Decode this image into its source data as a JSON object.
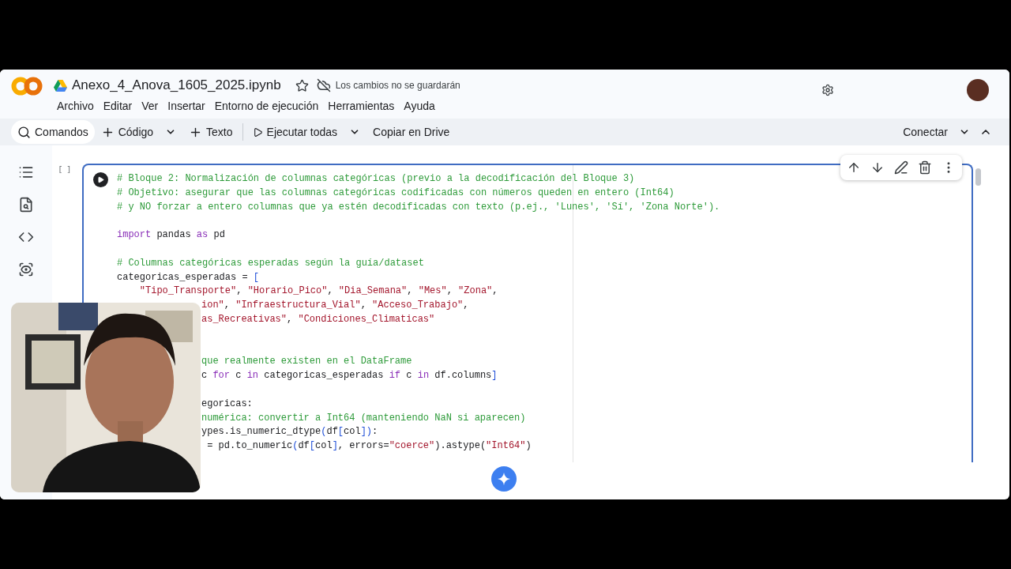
{
  "header": {
    "file_name": "Anexo_4_Anova_1605_2025.ipynb",
    "starred": false,
    "save_status": "Los cambios no se guardarán"
  },
  "menu": [
    "Archivo",
    "Editar",
    "Ver",
    "Insertar",
    "Entorno de ejecución",
    "Herramientas",
    "Ayuda"
  ],
  "toolbar": [
    {
      "label": "Comandos",
      "kind": "search",
      "dropdown": false
    },
    {
      "label": "Código",
      "kind": "add",
      "dropdown": true
    },
    {
      "label": "Texto",
      "kind": "add",
      "dropdown": false
    },
    {
      "label": "Ejecutar todas",
      "kind": "run",
      "dropdown": true
    },
    {
      "label": "Copiar en Drive",
      "kind": "plain",
      "dropdown": false
    }
  ],
  "connect": {
    "label": "Conectar"
  },
  "cell": {
    "exec_label": "[ ]",
    "lines": [
      {
        "kind": "full",
        "tokens": [
          {
            "text": "# Bloque 2: Normalización de columnas categóricas (previo a la decodificación del Bloque 3)",
            "kind": "comment"
          }
        ]
      },
      {
        "kind": "full",
        "tokens": [
          {
            "text": "# Objetivo: asegurar que las columnas categóricas codificadas con números queden en entero (Int64)",
            "kind": "comment"
          }
        ]
      },
      {
        "kind": "full",
        "tokens": [
          {
            "text": "# y NO forzar a entero columnas que ya estén decodificadas con texto (p.ej., 'Lunes', 'Sí', 'Zona Norte').",
            "kind": "comment"
          }
        ]
      },
      {
        "kind": "blank"
      },
      {
        "kind": "full",
        "tokens": [
          {
            "text": "import",
            "kind": "keyword"
          },
          {
            "text": " pandas ",
            "kind": "plain"
          },
          {
            "text": "as",
            "kind": "keyword"
          },
          {
            "text": " pd",
            "kind": "plain"
          }
        ]
      },
      {
        "kind": "blank"
      },
      {
        "kind": "full",
        "tokens": [
          {
            "text": "# Columnas categóricas esperadas según la guía/dataset",
            "kind": "comment"
          }
        ]
      },
      {
        "kind": "full",
        "tokens": [
          {
            "text": "categoricas_esperadas = ",
            "kind": "plain"
          },
          {
            "text": "[",
            "kind": "bracket"
          }
        ]
      },
      {
        "kind": "indented",
        "tokens": [
          {
            "text": "\"Tipo_Transporte\"",
            "kind": "string"
          },
          {
            "text": ", ",
            "kind": "plain"
          },
          {
            "text": "\"Horario_Pico\"",
            "kind": "string"
          },
          {
            "text": ", ",
            "kind": "plain"
          },
          {
            "text": "\"Dia_Semana\"",
            "kind": "string"
          },
          {
            "text": ", ",
            "kind": "plain"
          },
          {
            "text": "\"Mes\"",
            "kind": "string"
          },
          {
            "text": ", ",
            "kind": "plain"
          },
          {
            "text": "\"Zona\"",
            "kind": "string"
          },
          {
            "text": ",",
            "kind": "plain"
          }
        ]
      },
      {
        "kind": "cut",
        "tokens": [
          {
            "text": "ion\"",
            "kind": "string"
          },
          {
            "text": ", ",
            "kind": "plain"
          },
          {
            "text": "\"Infraestructura_Vial\"",
            "kind": "string"
          },
          {
            "text": ", ",
            "kind": "plain"
          },
          {
            "text": "\"Acceso_Trabajo\"",
            "kind": "string"
          },
          {
            "text": ",",
            "kind": "plain"
          }
        ]
      },
      {
        "kind": "cut",
        "tokens": [
          {
            "text": "as_Recreativas\"",
            "kind": "string"
          },
          {
            "text": ", ",
            "kind": "plain"
          },
          {
            "text": "\"Condiciones_Climaticas\"",
            "kind": "string"
          }
        ]
      },
      {
        "kind": "blank"
      },
      {
        "kind": "blank"
      },
      {
        "kind": "cut",
        "tokens": [
          {
            "text": "que realmente existen en el DataFrame",
            "kind": "comment"
          }
        ]
      },
      {
        "kind": "cut",
        "tokens": [
          {
            "text": "c ",
            "kind": "plain"
          },
          {
            "text": "for",
            "kind": "keyword"
          },
          {
            "text": " c ",
            "kind": "plain"
          },
          {
            "text": "in",
            "kind": "keyword"
          },
          {
            "text": " categoricas_esperadas ",
            "kind": "plain"
          },
          {
            "text": "if",
            "kind": "keyword"
          },
          {
            "text": " c ",
            "kind": "plain"
          },
          {
            "text": "in",
            "kind": "keyword"
          },
          {
            "text": " df.columns",
            "kind": "plain"
          },
          {
            "text": "]",
            "kind": "bracket"
          }
        ]
      },
      {
        "kind": "blank"
      },
      {
        "kind": "cut",
        "tokens": [
          {
            "text": "egoricas:",
            "kind": "plain"
          }
        ]
      },
      {
        "kind": "cut",
        "tokens": [
          {
            "text": "numérica: convertir a Int64 (manteniendo NaN si aparecen)",
            "kind": "comment"
          }
        ]
      },
      {
        "kind": "cut",
        "tokens": [
          {
            "text": "ypes.is_numeric_dtype",
            "kind": "plain"
          },
          {
            "text": "(",
            "kind": "bracket"
          },
          {
            "text": "df",
            "kind": "plain"
          },
          {
            "text": "[",
            "kind": "bracket"
          },
          {
            "text": "col",
            "kind": "plain"
          },
          {
            "text": "])",
            "kind": "bracket"
          },
          {
            "text": ":",
            "kind": "plain"
          }
        ]
      },
      {
        "kind": "cut",
        "tokens": [
          {
            "text": " = pd.to_numeric",
            "kind": "plain"
          },
          {
            "text": "(",
            "kind": "bracket"
          },
          {
            "text": "df",
            "kind": "plain"
          },
          {
            "text": "[",
            "kind": "bracket"
          },
          {
            "text": "col",
            "kind": "plain"
          },
          {
            "text": "]",
            "kind": "bracket"
          },
          {
            "text": ", errors=",
            "kind": "plain"
          },
          {
            "text": "\"coerce\"",
            "kind": "string"
          },
          {
            "text": ").astype(",
            "kind": "plain"
          },
          {
            "text": "\"Int64\"",
            "kind": "string"
          },
          {
            "text": ")",
            "kind": "plain"
          }
        ]
      }
    ]
  }
}
